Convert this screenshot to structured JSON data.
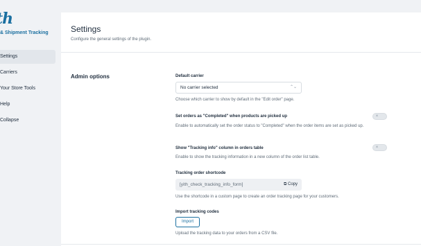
{
  "sidebar": {
    "logo_text": "th",
    "brand": "& Shipment Tracking",
    "items": [
      {
        "label": "Settings"
      },
      {
        "label": "Carriers"
      },
      {
        "label": "Your Store Tools"
      },
      {
        "label": "Help"
      },
      {
        "label": "Collapse"
      }
    ]
  },
  "header": {
    "title": "Settings",
    "description": "Configure the general settings of the plugin."
  },
  "section": {
    "title": "Admin options"
  },
  "options": {
    "default_carrier": {
      "label": "Default carrier",
      "value": "No carrier selected",
      "description": "Choose which carrier to show by default in the \"Edit order\" page."
    },
    "completed": {
      "label": "Set orders as \"Completed\" when products are picked up",
      "description": "Enable to automatically set the order status to \"Completed\" when the order items are set as picked up.",
      "enabled": false
    },
    "tracking_column": {
      "label": "Show \"Tracking info\" column in orders table",
      "description": "Enable to show the tracking information in a new column of the order list table.",
      "enabled": false
    },
    "shortcode": {
      "label": "Tracking order shortcode",
      "value": "[yith_check_tracking_info_form]",
      "copy_label": "Copy",
      "description": "Use the shortcode in a custom page to create an order tracking page for your customers."
    },
    "import": {
      "label": "Import tracking codes",
      "button_label": "Import",
      "description": "Upload the tracking data to your orders from a CSV file."
    }
  },
  "colors": {
    "accent": "#1a6fa0",
    "background": "#f0f2f5"
  }
}
